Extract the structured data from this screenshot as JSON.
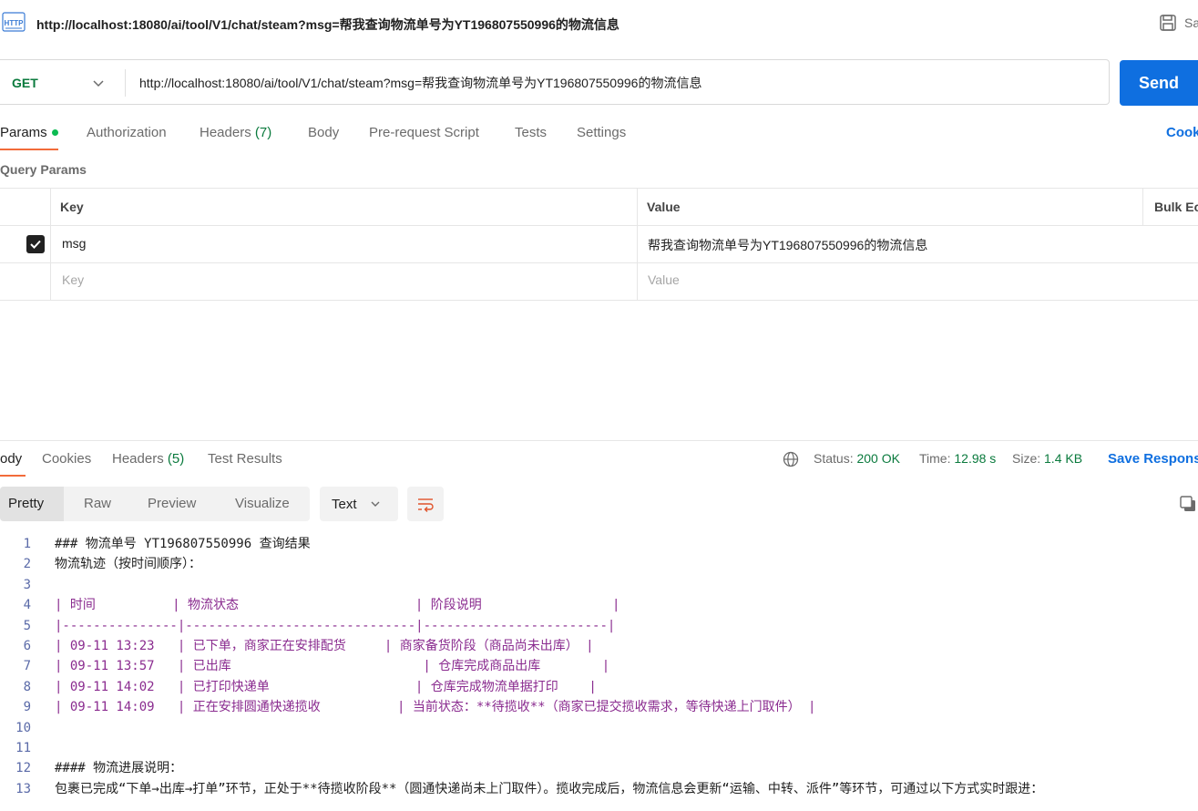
{
  "header": {
    "title": "http://localhost:18080/ai/tool/V1/chat/steam?msg=帮我查询物流单号为YT196807550996的物流信息",
    "save_label": "Sa",
    "http_icon_label": "HTTP"
  },
  "request": {
    "method": "GET",
    "url": "http://localhost:18080/ai/tool/V1/chat/steam?msg=帮我查询物流单号为YT196807550996的物流信息",
    "send_label": "Send"
  },
  "request_tabs": {
    "params": "Params",
    "authorization": "Authorization",
    "headers": "Headers",
    "headers_count": "(7)",
    "body": "Body",
    "pre_request": "Pre-request Script",
    "tests": "Tests",
    "settings": "Settings",
    "cookies": "Cook"
  },
  "query_params": {
    "label": "Query Params",
    "col_key": "Key",
    "col_value": "Value",
    "bulk_edit": "Bulk Ec",
    "rows": [
      {
        "checked": true,
        "key": "msg",
        "value": "帮我查询物流单号为YT196807550996的物流信息"
      }
    ],
    "placeholder_key": "Key",
    "placeholder_value": "Value"
  },
  "response_tabs": {
    "body": "ody",
    "cookies": "Cookies",
    "headers": "Headers",
    "headers_count": "(5)",
    "test_results": "Test Results"
  },
  "response_status": {
    "status_label": "Status:",
    "status_value": "200 OK",
    "time_label": "Time:",
    "time_value": "12.98 s",
    "size_label": "Size:",
    "size_value": "1.4 KB",
    "save_response": "Save Respons"
  },
  "view_toolbar": {
    "pretty": "Pretty",
    "raw": "Raw",
    "preview": "Preview",
    "visualize": "Visualize",
    "format": "Text"
  },
  "response_lines": [
    {
      "n": "1",
      "text": "### 物流单号 YT196807550996 查询结果",
      "color": "#212121"
    },
    {
      "n": "2",
      "text": "物流轨迹（按时间顺序）：",
      "color": "#212121"
    },
    {
      "n": "3",
      "text": "",
      "color": "#212121"
    },
    {
      "n": "4",
      "text": "| 时间          | 物流状态                       | 阶段说明                 |",
      "color": "#8a2b8f"
    },
    {
      "n": "5",
      "text": "|---------------|------------------------------|------------------------|",
      "color": "#8a2b8f"
    },
    {
      "n": "6",
      "text": "| 09-11 13:23   | 已下单，商家正在安排配货     | 商家备货阶段（商品尚未出库） |",
      "color": "#8a2b8f"
    },
    {
      "n": "7",
      "text": "| 09-11 13:57   | 已出库                         | 仓库完成商品出库        |",
      "color": "#8a2b8f"
    },
    {
      "n": "8",
      "text": "| 09-11 14:02   | 已打印快递单                   | 仓库完成物流单据打印    |",
      "color": "#8a2b8f"
    },
    {
      "n": "9",
      "text": "| 09-11 14:09   | 正在安排圆通快递揽收          | 当前状态：**待揽收**（商家已提交揽收需求，等待快递上门取件） |",
      "color": "#8a2b8f"
    },
    {
      "n": "10",
      "text": "",
      "color": "#212121"
    },
    {
      "n": "11",
      "text": "",
      "color": "#212121"
    },
    {
      "n": "12",
      "text": "#### 物流进展说明：",
      "color": "#212121"
    },
    {
      "n": "13",
      "text": "包裹已完成“下单→出库→打单”环节，正处于**待揽收阶段**（圆通快递尚未上门取件）。揽收完成后，物流信息会更新“运输、中转、派件”等环节，可通过以下方式实时跟进：",
      "color": "#212121"
    }
  ]
}
